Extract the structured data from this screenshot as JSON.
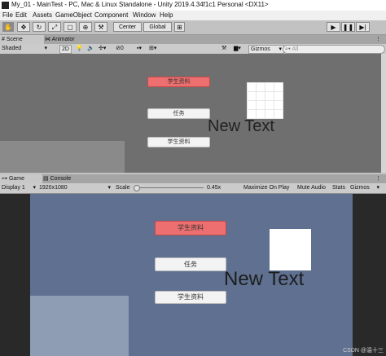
{
  "window": {
    "title": "My_01 - MainTest - PC, Mac & Linux Standalone - Unity 2019.4.34f1c1 Personal <DX11>"
  },
  "menu": [
    "File",
    "Edit",
    "Assets",
    "GameObject",
    "Component",
    "Window",
    "Help"
  ],
  "toolbar": {
    "pivot_label": "Center",
    "space_label": "Global"
  },
  "scene_tabs": {
    "scene": "Scene",
    "animator": "Animator"
  },
  "scene_controls": {
    "shading": "Shaded",
    "mode_2d": "2D",
    "hidden_count": "0",
    "gizmos": "Gizmos",
    "search_placeholder": "All"
  },
  "game_tabs": {
    "game": "Game",
    "console": "Console"
  },
  "game_controls": {
    "display": "Display 1",
    "resolution": "1920x1080",
    "scale_label": "Scale",
    "scale_value": "0.45x",
    "maximize": "Maximize On Play",
    "mute": "Mute Audio",
    "stats": "Stats",
    "gizmos": "Gizmos",
    "scale_fraction": 0.0
  },
  "canvas": {
    "button1": "学生资料",
    "button2": "任务",
    "button3": "学生资料",
    "big_text": "New Text"
  },
  "watermark": "CSDN @温十三",
  "colors": {
    "red_button": "#ee6f6f",
    "scene_bg": "#6f6f6f",
    "game_bg": "#5f7090"
  }
}
